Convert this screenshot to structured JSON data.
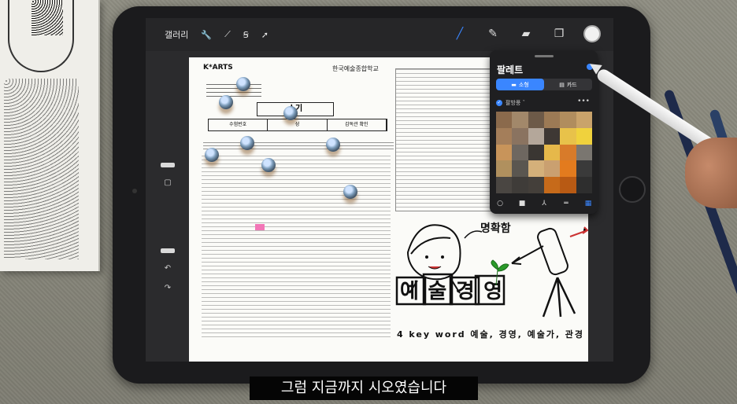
{
  "toolbar": {
    "gallery_label": "갤러리"
  },
  "document": {
    "logo": "K*ARTS",
    "school": "한국예술종합학교",
    "exam_title": "소기",
    "header_line": "2021학년도",
    "info_cells": [
      "수험번호",
      "성",
      "감독관 확인"
    ]
  },
  "drawing": {
    "label_top": "명확함",
    "main_word": "예술경영",
    "keywords": "4 key word  예술, 경영, 예술가, 관경"
  },
  "palette": {
    "title": "팔레트",
    "tab_compact": "소형",
    "tab_card": "카드",
    "palette_name": "팔방풍 ˇ",
    "swatches": [
      "#8b6a4c",
      "#a2886a",
      "#6d5a48",
      "#9c7a55",
      "#b08d5e",
      "#c9a36b",
      "#a47e5a",
      "#8a7360",
      "#b4a79a",
      "#3e3834",
      "#e8c24a",
      "#f0d23d",
      "#c8945a",
      "#6e6760",
      "#3a3632",
      "#e6b84a",
      "#d87b2a",
      "#7a7670",
      "#b0905e",
      "#5a5650",
      "#d4b07a",
      "#caa070",
      "#e37b1e",
      "#3a3a3a",
      "#4a4642",
      "#3f3c39",
      "#443f3a",
      "#c66a1a",
      "#b85a14",
      "#2e2e2e"
    ],
    "accent_color": "#3a86ff"
  },
  "subtitle": "그럼 지금까지 시오였습니다"
}
